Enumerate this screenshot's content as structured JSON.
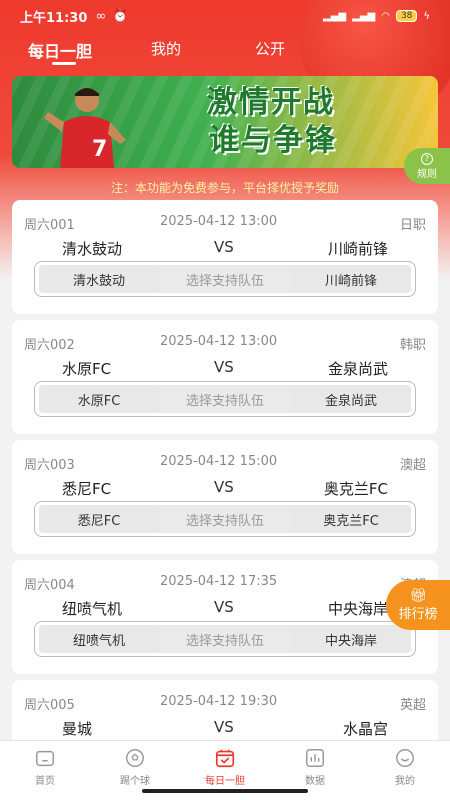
{
  "status": {
    "time": "上午11:30",
    "battery": "38"
  },
  "tabs": [
    {
      "label": "每日一胆"
    },
    {
      "label": "我的"
    },
    {
      "label": "公开"
    }
  ],
  "banner": {
    "line1": "激情开战",
    "line2": "谁与争锋"
  },
  "rules_label": "规则",
  "notice": "注：本功能为免费参与，平台择优授予奖励",
  "choose_label": "选择支持队伍",
  "vs_label": "VS",
  "matches": [
    {
      "code": "周六001",
      "datetime": "2025-04-12 13:00",
      "league": "日职",
      "home": "清水鼓动",
      "away": "川崎前锋"
    },
    {
      "code": "周六002",
      "datetime": "2025-04-12 13:00",
      "league": "韩职",
      "home": "水原FC",
      "away": "金泉尚武"
    },
    {
      "code": "周六003",
      "datetime": "2025-04-12 15:00",
      "league": "澳超",
      "home": "悉尼FC",
      "away": "奥克兰FC"
    },
    {
      "code": "周六004",
      "datetime": "2025-04-12 17:35",
      "league": "澳超",
      "home": "纽喷气机",
      "away": "中央海岸"
    },
    {
      "code": "周六005",
      "datetime": "2025-04-12 19:30",
      "league": "英超",
      "home": "曼城",
      "away": "水晶宫"
    }
  ],
  "rank_label": "排行榜",
  "nav": [
    {
      "label": "首页",
      "icon": "home-icon"
    },
    {
      "label": "踢个球",
      "icon": "football-icon"
    },
    {
      "label": "每日一胆",
      "icon": "calendar-check-icon"
    },
    {
      "label": "数据",
      "icon": "chart-icon"
    },
    {
      "label": "我的",
      "icon": "smile-icon"
    }
  ],
  "colors": {
    "primary": "#ef3a2e",
    "accent": "#f5931e",
    "notice": "#fff5a0"
  }
}
